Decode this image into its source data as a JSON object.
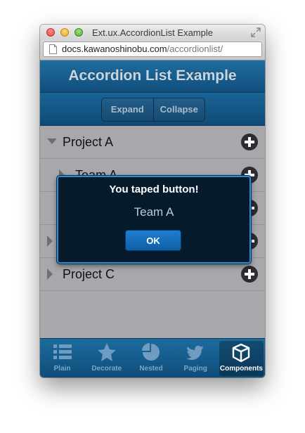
{
  "window": {
    "title": "Ext.ux.AccordionList Example",
    "url_domain": "docs.kawanoshinobu.com",
    "url_path": "/accordionlist/"
  },
  "header": {
    "title": "Accordion List Example"
  },
  "toolbar": {
    "expand_label": "Expand",
    "collapse_label": "Collapse"
  },
  "list": {
    "items": [
      {
        "label": "Project A",
        "expanded": true,
        "level": 0
      },
      {
        "label": "Team A",
        "expanded": false,
        "level": 1
      },
      {
        "label": "",
        "expanded": false,
        "level": 1
      },
      {
        "label": "",
        "expanded": false,
        "level": 0
      },
      {
        "label": "Project C",
        "expanded": false,
        "level": 0
      }
    ]
  },
  "dialog": {
    "title": "You taped button!",
    "message": "Team A",
    "ok_label": "OK"
  },
  "tabs": [
    {
      "label": "Plain",
      "icon": "list-icon"
    },
    {
      "label": "Decorate",
      "icon": "star-icon"
    },
    {
      "label": "Nested",
      "icon": "pie-chart-icon"
    },
    {
      "label": "Paging",
      "icon": "bird-icon"
    },
    {
      "label": "Components",
      "icon": "cube-icon",
      "active": true
    }
  ],
  "colors": {
    "header_blue": "#114e7c",
    "dialog_border": "#2e8cd3",
    "ok_button": "#1d7fd0",
    "list_background": "#a8a8ac"
  }
}
